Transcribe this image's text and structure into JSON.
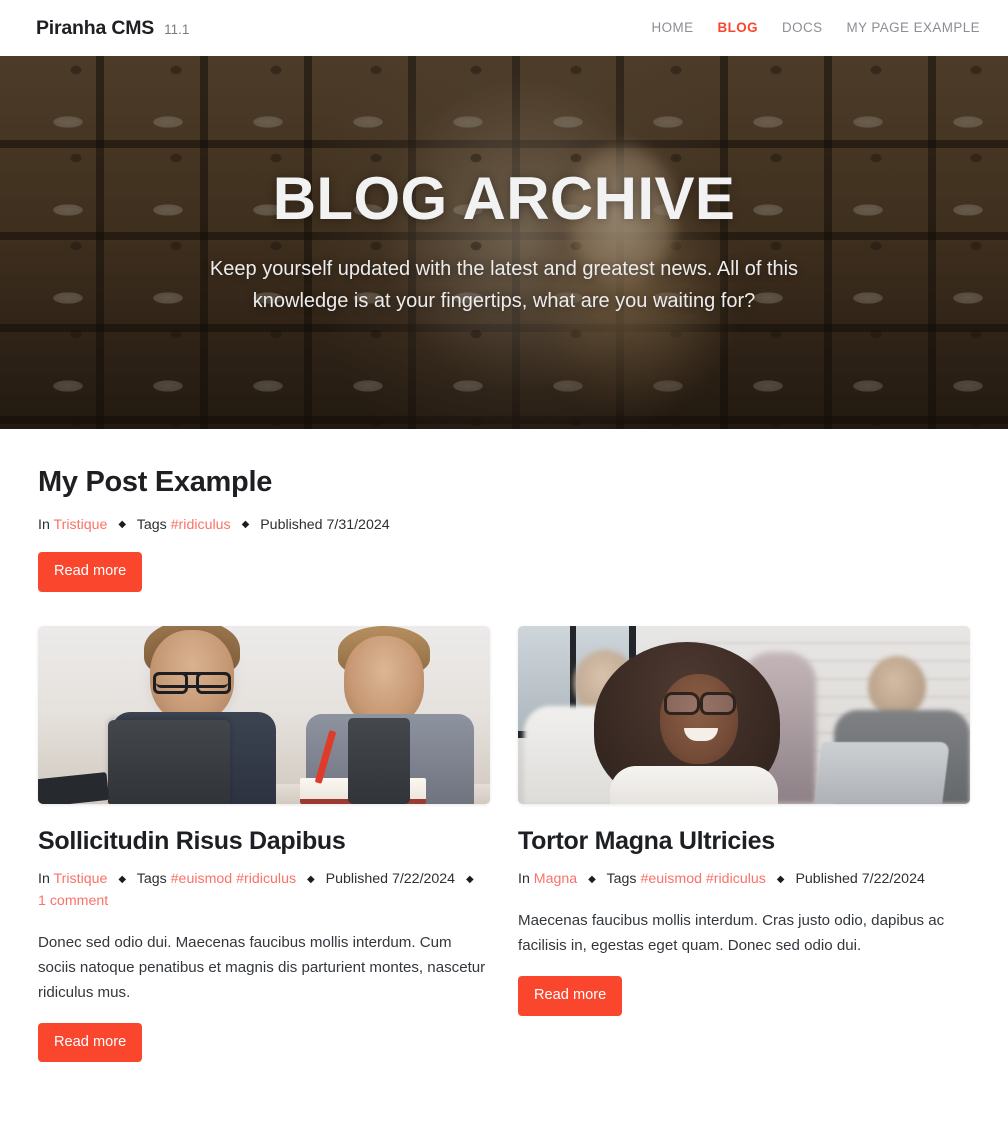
{
  "header": {
    "brand_name": "Piranha CMS",
    "brand_version": "11.1",
    "nav": [
      {
        "label": "HOME",
        "active": false
      },
      {
        "label": "BLOG",
        "active": true
      },
      {
        "label": "DOCS",
        "active": false
      },
      {
        "label": "MY PAGE EXAMPLE",
        "active": false
      }
    ]
  },
  "hero": {
    "title": "BLOG ARCHIVE",
    "subtitle": "Keep yourself updated with the latest and greatest news. All of this knowledge is at your fingertips, what are you waiting for?"
  },
  "featured_post": {
    "title": "My Post Example",
    "meta": {
      "in_label": "In",
      "category": "Tristique",
      "tags_label": "Tags",
      "tags": "#ridiculus",
      "published_label": "Published",
      "published_date": "7/31/2024",
      "separator": "◆"
    },
    "read_more_label": "Read more"
  },
  "posts": [
    {
      "title": "Sollicitudin Risus Dapibus",
      "image_name": "two-children-studying-with-tablets",
      "meta": {
        "in_label": "In",
        "category": "Tristique",
        "tags_label": "Tags",
        "tags": "#euismod #ridiculus",
        "published_label": "Published",
        "published_date": "7/22/2024",
        "comments": "1 comment",
        "separator": "◆"
      },
      "excerpt": "Donec sed odio dui. Maecenas faucibus mollis interdum. Cum sociis natoque penatibus et magnis dis parturient montes, nascetur ridiculus mus.",
      "read_more_label": "Read more"
    },
    {
      "title": "Tortor Magna Ultricies",
      "image_name": "smiling-woman-in-office-with-colleagues",
      "meta": {
        "in_label": "In",
        "category": "Magna",
        "tags_label": "Tags",
        "tags": "#euismod #ridiculus",
        "published_label": "Published",
        "published_date": "7/22/2024",
        "comments": null,
        "separator": "◆"
      },
      "excerpt": "Maecenas faucibus mollis interdum. Cras justo odio, dapibus ac facilisis in, egestas eget quam. Donec sed odio dui.",
      "read_more_label": "Read more"
    }
  ],
  "colors": {
    "accent": "#f9462c",
    "link": "#fa7268",
    "nav_inactive": "#8b8e93",
    "text": "#1d1f23",
    "body_text": "#33373c"
  }
}
